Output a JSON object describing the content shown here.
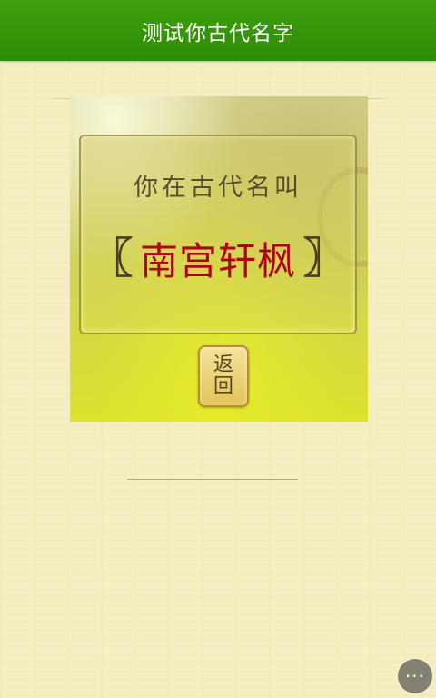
{
  "header": {
    "title": "测试你古代名字"
  },
  "result": {
    "label": "你在古代名叫",
    "bracket_left": "〖",
    "name": "南宫轩枫",
    "bracket_right": "〗",
    "back_label": "返回"
  },
  "menu": {
    "more_label": "···"
  },
  "colors": {
    "header_green": "#3ea10d",
    "name_red": "#b1001a",
    "page_bg": "#f6efc4"
  }
}
